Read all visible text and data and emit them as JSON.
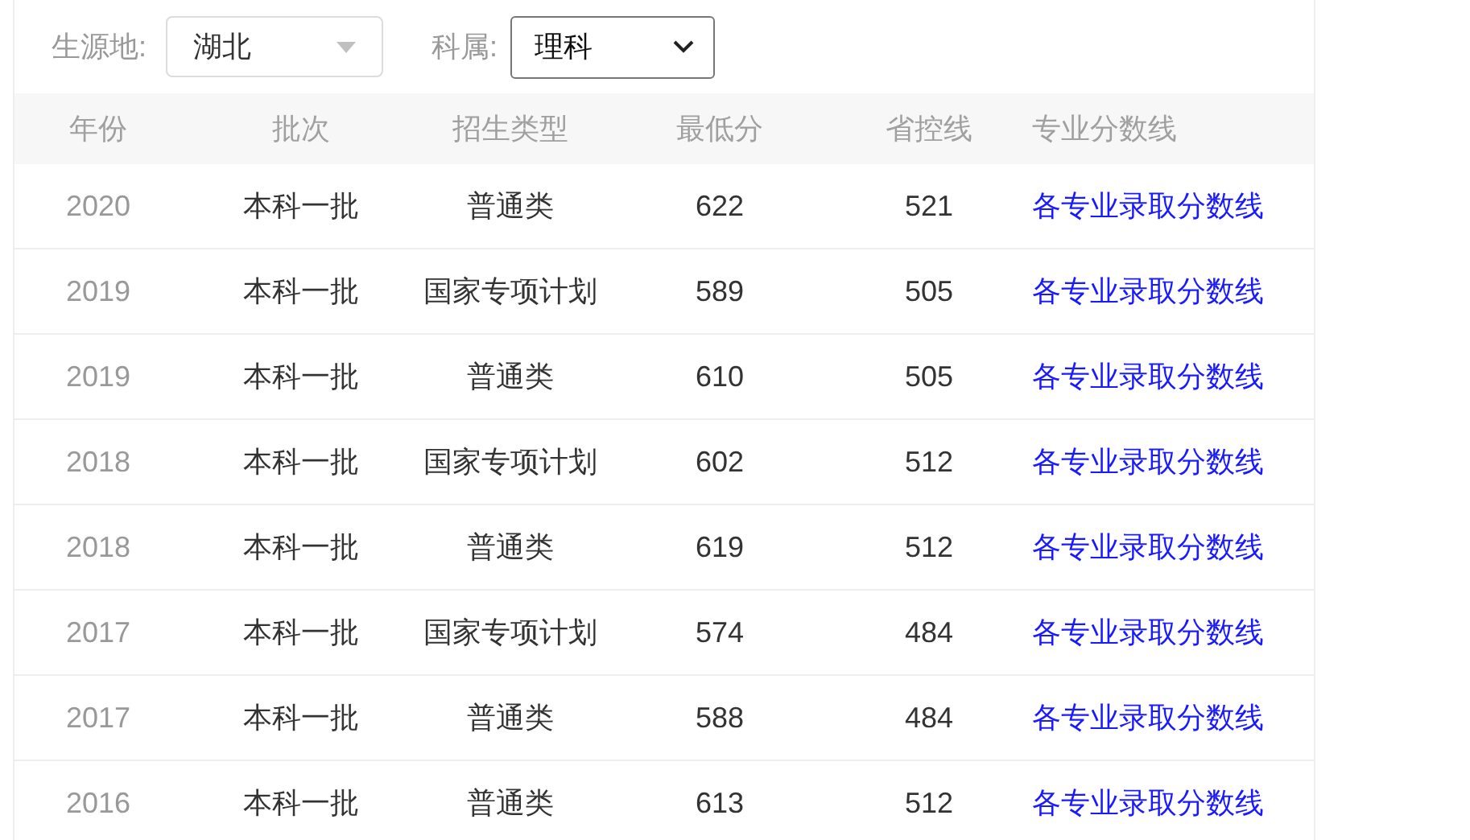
{
  "filters": [
    {
      "kind": "dropdown",
      "label": "生源地:",
      "value": "湖北"
    },
    {
      "kind": "select",
      "label": "科属:",
      "value": "理科"
    }
  ],
  "table": {
    "columns": [
      "年份",
      "批次",
      "招生类型",
      "最低分",
      "省控线",
      "专业分数线"
    ],
    "rows": [
      {
        "year": "2020",
        "batch": "本科一批",
        "type": "普通类",
        "min": "622",
        "line": "521",
        "link": "各专业录取分数线"
      },
      {
        "year": "2019",
        "batch": "本科一批",
        "type": "国家专项计划",
        "min": "589",
        "line": "505",
        "link": "各专业录取分数线"
      },
      {
        "year": "2019",
        "batch": "本科一批",
        "type": "普通类",
        "min": "610",
        "line": "505",
        "link": "各专业录取分数线"
      },
      {
        "year": "2018",
        "batch": "本科一批",
        "type": "国家专项计划",
        "min": "602",
        "line": "512",
        "link": "各专业录取分数线"
      },
      {
        "year": "2018",
        "batch": "本科一批",
        "type": "普通类",
        "min": "619",
        "line": "512",
        "link": "各专业录取分数线"
      },
      {
        "year": "2017",
        "batch": "本科一批",
        "type": "国家专项计划",
        "min": "574",
        "line": "484",
        "link": "各专业录取分数线"
      },
      {
        "year": "2017",
        "batch": "本科一批",
        "type": "普通类",
        "min": "588",
        "line": "484",
        "link": "各专业录取分数线"
      },
      {
        "year": "2016",
        "batch": "本科一批",
        "type": "普通类",
        "min": "613",
        "line": "512",
        "link": "各专业录取分数线"
      }
    ]
  }
}
